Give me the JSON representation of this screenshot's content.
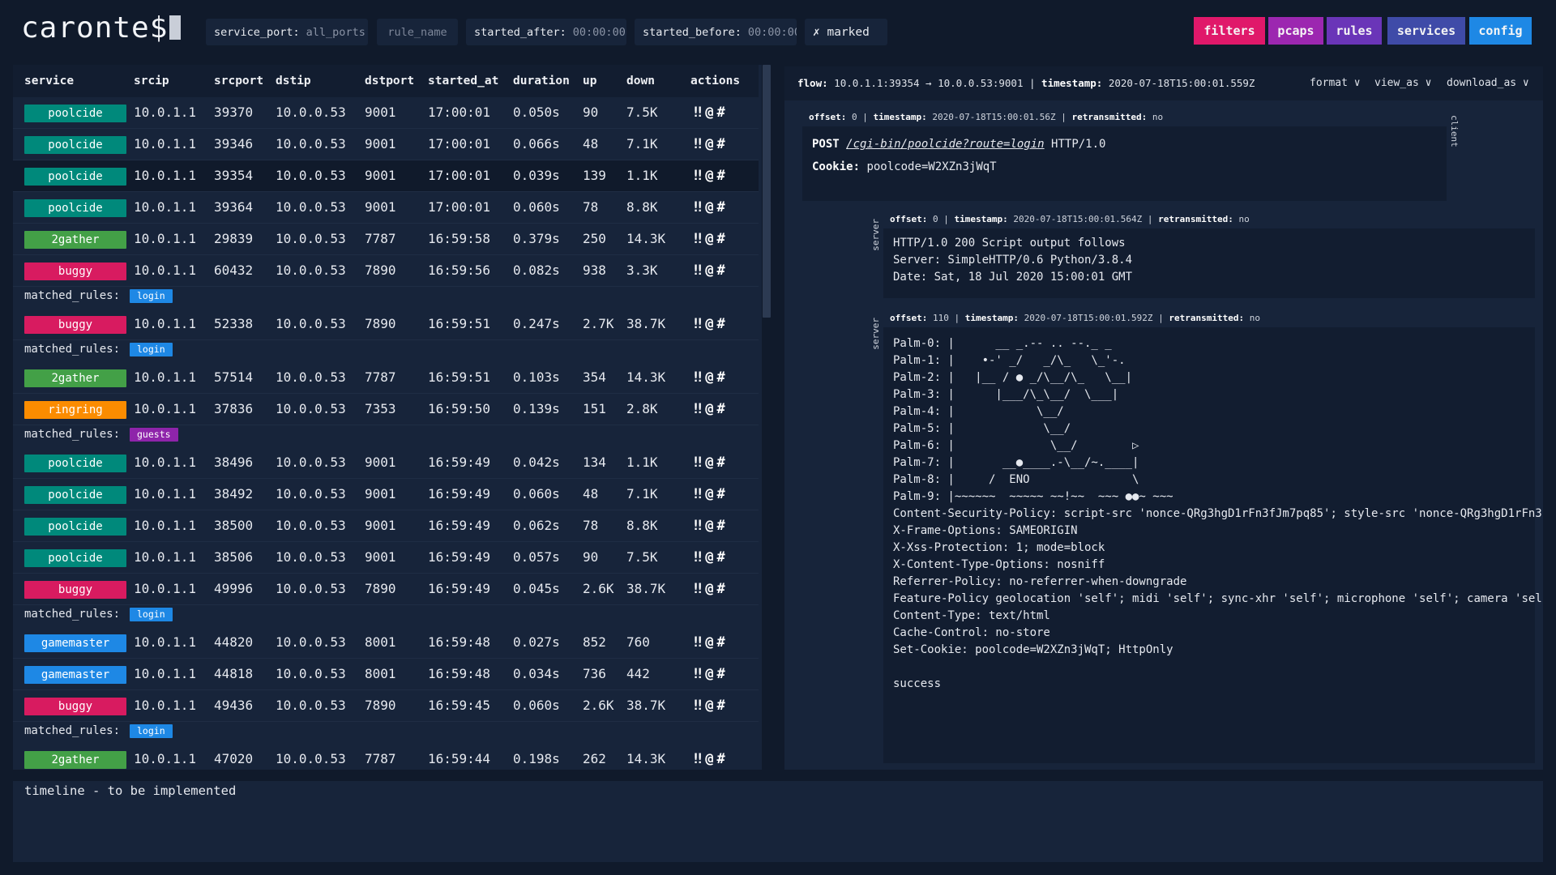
{
  "app": {
    "logo": "caronte$"
  },
  "filters": {
    "service_port_label": "service_port:",
    "service_port_value": "all_ports",
    "rule_name_placeholder": "rule_name",
    "started_after_label": "started_after:",
    "started_after_value": "00:00:00",
    "started_before_label": "started_before:",
    "started_before_value": "00:00:00",
    "marked_label": "✗ marked"
  },
  "nav": [
    {
      "label": "filters",
      "color": "#e0186a"
    },
    {
      "label": "pcaps",
      "color": "#9c27b0"
    },
    {
      "label": "rules",
      "color": "#6a35b8"
    },
    {
      "label": "services",
      "color": "#3f4ba8"
    },
    {
      "label": "config",
      "color": "#1e88e5"
    }
  ],
  "table": {
    "columns": [
      "service",
      "srcip",
      "srcport",
      "dstip",
      "dstport",
      "started_at",
      "duration",
      "up",
      "down",
      "actions"
    ],
    "rows": [
      {
        "service": "poolcide",
        "color": "#00897b",
        "srcip": "10.0.1.1",
        "srcport": "39370",
        "dstip": "10.0.0.53",
        "dstport": "9001",
        "started_at": "17:00:01",
        "duration": "0.050s",
        "up": "90",
        "down": "7.5K",
        "actions": "‼@#",
        "rule": ""
      },
      {
        "service": "poolcide",
        "color": "#00897b",
        "srcip": "10.0.1.1",
        "srcport": "39346",
        "dstip": "10.0.0.53",
        "dstport": "9001",
        "started_at": "17:00:01",
        "duration": "0.066s",
        "up": "48",
        "down": "7.1K",
        "actions": "‼@#",
        "rule": ""
      },
      {
        "service": "poolcide",
        "color": "#00897b",
        "srcip": "10.0.1.1",
        "srcport": "39354",
        "dstip": "10.0.0.53",
        "dstport": "9001",
        "started_at": "17:00:01",
        "duration": "0.039s",
        "up": "139",
        "down": "1.1K",
        "actions": "‼@#",
        "rule": "",
        "selected": true
      },
      {
        "service": "poolcide",
        "color": "#00897b",
        "srcip": "10.0.1.1",
        "srcport": "39364",
        "dstip": "10.0.0.53",
        "dstport": "9001",
        "started_at": "17:00:01",
        "duration": "0.060s",
        "up": "78",
        "down": "8.8K",
        "actions": "‼@#",
        "rule": ""
      },
      {
        "service": "2gather",
        "color": "#43a047",
        "srcip": "10.0.1.1",
        "srcport": "29839",
        "dstip": "10.0.0.53",
        "dstport": "7787",
        "started_at": "16:59:58",
        "duration": "0.379s",
        "up": "250",
        "down": "14.3K",
        "actions": "‼@#",
        "rule": ""
      },
      {
        "service": "buggy",
        "color": "#d81b60",
        "srcip": "10.0.1.1",
        "srcport": "60432",
        "dstip": "10.0.0.53",
        "dstport": "7890",
        "started_at": "16:59:56",
        "duration": "0.082s",
        "up": "938",
        "down": "3.3K",
        "actions": "‼@#",
        "rule": "login",
        "rule_color": "#1e88e5"
      },
      {
        "service": "buggy",
        "color": "#d81b60",
        "srcip": "10.0.1.1",
        "srcport": "52338",
        "dstip": "10.0.0.53",
        "dstport": "7890",
        "started_at": "16:59:51",
        "duration": "0.247s",
        "up": "2.7K",
        "down": "38.7K",
        "actions": "‼@#",
        "rule": "login",
        "rule_color": "#1e88e5"
      },
      {
        "service": "2gather",
        "color": "#43a047",
        "srcip": "10.0.1.1",
        "srcport": "57514",
        "dstip": "10.0.0.53",
        "dstport": "7787",
        "started_at": "16:59:51",
        "duration": "0.103s",
        "up": "354",
        "down": "14.3K",
        "actions": "‼@#",
        "rule": ""
      },
      {
        "service": "ringring",
        "color": "#fb8c00",
        "srcip": "10.0.1.1",
        "srcport": "37836",
        "dstip": "10.0.0.53",
        "dstport": "7353",
        "started_at": "16:59:50",
        "duration": "0.139s",
        "up": "151",
        "down": "2.8K",
        "actions": "‼@#",
        "rule": "guests",
        "rule_color": "#8e24aa"
      },
      {
        "service": "poolcide",
        "color": "#00897b",
        "srcip": "10.0.1.1",
        "srcport": "38496",
        "dstip": "10.0.0.53",
        "dstport": "9001",
        "started_at": "16:59:49",
        "duration": "0.042s",
        "up": "134",
        "down": "1.1K",
        "actions": "‼@#",
        "rule": ""
      },
      {
        "service": "poolcide",
        "color": "#00897b",
        "srcip": "10.0.1.1",
        "srcport": "38492",
        "dstip": "10.0.0.53",
        "dstport": "9001",
        "started_at": "16:59:49",
        "duration": "0.060s",
        "up": "48",
        "down": "7.1K",
        "actions": "‼@#",
        "rule": ""
      },
      {
        "service": "poolcide",
        "color": "#00897b",
        "srcip": "10.0.1.1",
        "srcport": "38500",
        "dstip": "10.0.0.53",
        "dstport": "9001",
        "started_at": "16:59:49",
        "duration": "0.062s",
        "up": "78",
        "down": "8.8K",
        "actions": "‼@#",
        "rule": ""
      },
      {
        "service": "poolcide",
        "color": "#00897b",
        "srcip": "10.0.1.1",
        "srcport": "38506",
        "dstip": "10.0.0.53",
        "dstport": "9001",
        "started_at": "16:59:49",
        "duration": "0.057s",
        "up": "90",
        "down": "7.5K",
        "actions": "‼@#",
        "rule": ""
      },
      {
        "service": "buggy",
        "color": "#d81b60",
        "srcip": "10.0.1.1",
        "srcport": "49996",
        "dstip": "10.0.0.53",
        "dstport": "7890",
        "started_at": "16:59:49",
        "duration": "0.045s",
        "up": "2.6K",
        "down": "38.7K",
        "actions": "‼@#",
        "rule": "login",
        "rule_color": "#1e88e5"
      },
      {
        "service": "gamemaster",
        "color": "#1e88e5",
        "srcip": "10.0.1.1",
        "srcport": "44820",
        "dstip": "10.0.0.53",
        "dstport": "8001",
        "started_at": "16:59:48",
        "duration": "0.027s",
        "up": "852",
        "down": "760",
        "actions": "‼@#",
        "rule": ""
      },
      {
        "service": "gamemaster",
        "color": "#1e88e5",
        "srcip": "10.0.1.1",
        "srcport": "44818",
        "dstip": "10.0.0.53",
        "dstport": "8001",
        "started_at": "16:59:48",
        "duration": "0.034s",
        "up": "736",
        "down": "442",
        "actions": "‼@#",
        "rule": ""
      },
      {
        "service": "buggy",
        "color": "#d81b60",
        "srcip": "10.0.1.1",
        "srcport": "49436",
        "dstip": "10.0.0.53",
        "dstport": "7890",
        "started_at": "16:59:45",
        "duration": "0.060s",
        "up": "2.6K",
        "down": "38.7K",
        "actions": "‼@#",
        "rule": "login",
        "rule_color": "#1e88e5"
      },
      {
        "service": "2gather",
        "color": "#43a047",
        "srcip": "10.0.1.1",
        "srcport": "47020",
        "dstip": "10.0.0.53",
        "dstport": "7787",
        "started_at": "16:59:44",
        "duration": "0.198s",
        "up": "262",
        "down": "14.3K",
        "actions": "‼@#",
        "rule": ""
      }
    ],
    "matched_rules_label": "matched_rules:"
  },
  "detail": {
    "flow_label": "flow:",
    "flow_value": "10.0.1.1:39354 → 10.0.0.53:9001",
    "timestamp_label": "timestamp:",
    "timestamp_value": "2020-07-18T15:00:01.559Z",
    "menus": [
      "format ∨",
      "view_as ∨",
      "download_as ∨"
    ],
    "messages": [
      {
        "side": "client",
        "offset": "0",
        "timestamp": "2020-07-18T15:00:01.56Z",
        "retransmitted": "no",
        "method": "POST",
        "path": "/cgi-bin/poolcide?route=login",
        "proto": "HTTP/1.0",
        "cookie_label": "Cookie:",
        "cookie_value": "poolcode=W2XZn3jWqT"
      },
      {
        "side": "server",
        "offset": "0",
        "timestamp": "2020-07-18T15:00:01.564Z",
        "retransmitted": "no",
        "body": "HTTP/1.0 200 Script output follows\nServer: SimpleHTTP/0.6 Python/3.8.4\nDate: Sat, 18 Jul 2020 15:00:01 GMT"
      },
      {
        "side": "server",
        "offset": "110",
        "timestamp": "2020-07-18T15:00:01.592Z",
        "retransmitted": "no",
        "body": "Palm-0: |      __ _.-- .. --._ _\nPalm-1: |    •-' _/   _/\\_   \\_'-.\nPalm-2: |   |__ / ● _/\\__/\\_   \\__|\nPalm-3: |      |___/\\_\\__/  \\___|\nPalm-4: |            \\__/\nPalm-5: |             \\__/\nPalm-6: |              \\__/        ▷\nPalm-7: |       __●____.-\\__/~.____|\nPalm-8: |     /  ENO               \\\nPalm-9: |~~~~~~  ~~~~~ ~~!~~  ~~~ ●●~ ~~~\nContent-Security-Policy: script-src 'nonce-QRg3hgD1rFn3fJm7pq85'; style-src 'nonce-QRg3hgD1rFn3fJm7pq85' https://fonts.googleapis.com/css2?family=Lobster&display=swap;\nX-Frame-Options: SAMEORIGIN\nX-Xss-Protection: 1; mode=block\nX-Content-Type-Options: nosniff\nReferrer-Policy: no-referrer-when-downgrade\nFeature-Policy geolocation 'self'; midi 'self'; sync-xhr 'self'; microphone 'self'; camera 'self'; magnetometer 'self'; gyroscope 'self'; speaker 'self'; fullscreen *; payment 'self';\nContent-Type: text/html\nCache-Control: no-store\nSet-Cookie: poolcode=W2XZn3jWqT; HttpOnly\n\nsuccess"
      }
    ],
    "offset_label": "offset:",
    "ts_label": "timestamp:",
    "retrans_label": "retransmitted:"
  },
  "timeline": {
    "text": "timeline - to be implemented"
  }
}
